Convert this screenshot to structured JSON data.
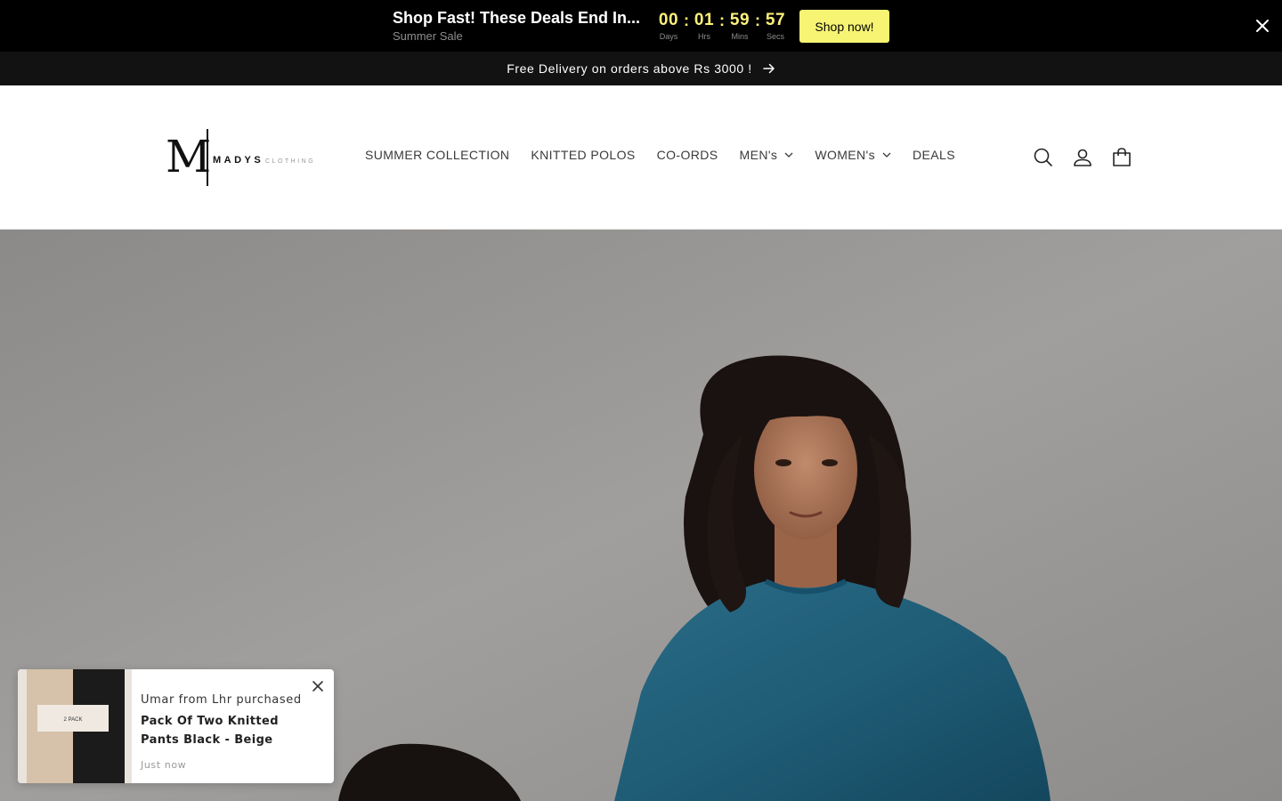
{
  "countdown": {
    "title": "Shop Fast! These Deals End In...",
    "subtitle": "Summer Sale",
    "days": "00",
    "days_label": "Days",
    "hours": "01",
    "hours_label": "Hrs",
    "mins": "59",
    "mins_label": "Mins",
    "secs": "57",
    "secs_label": "Secs",
    "separator": ":",
    "button_label": "Shop now!",
    "accent_color": "#fdf17a",
    "button_color": "#f7f474"
  },
  "announcement": {
    "text": "Free Delivery on orders above Rs 3000 !"
  },
  "logo": {
    "mark": "M",
    "word": "MADYS",
    "sub": "CLOTHING"
  },
  "nav": {
    "items": [
      {
        "label": "SUMMER COLLECTION"
      },
      {
        "label": "KNITTED POLOS"
      },
      {
        "label": "CO-ORDS"
      },
      {
        "label": "MEN's"
      },
      {
        "label": "WOMEN's"
      },
      {
        "label": "DEALS"
      }
    ]
  },
  "header_icons": [
    "search-icon",
    "account-icon",
    "cart-icon"
  ],
  "toast": {
    "who": "Umar from Lhr purchased",
    "product": "Pack Of Two Knitted Pants Black - Beige",
    "time": "Just now",
    "image_text": "2 PACK"
  }
}
